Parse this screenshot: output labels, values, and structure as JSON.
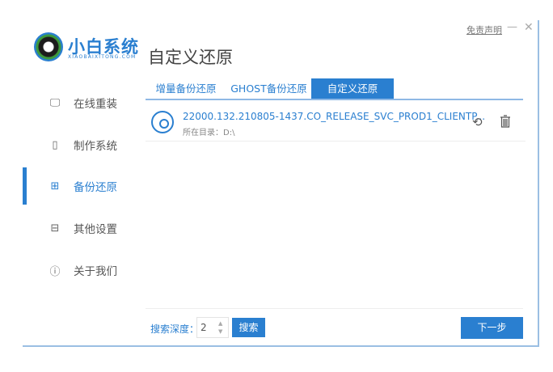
{
  "header": {
    "brand": "小白系统",
    "brand_sub": "XIAOBAIXITONG.COM",
    "title": "自定义还原",
    "disclaimer": "免责声明",
    "minimize": "—",
    "close": "✕"
  },
  "sidebar": {
    "items": [
      {
        "label": "在线重装",
        "icon": "monitor-icon"
      },
      {
        "label": "制作系统",
        "icon": "usb-icon"
      },
      {
        "label": "备份还原",
        "icon": "backup-icon"
      },
      {
        "label": "其他设置",
        "icon": "briefcase-icon"
      },
      {
        "label": "关于我们",
        "icon": "info-icon"
      }
    ],
    "active": 2
  },
  "tabs": [
    {
      "label": "增量备份还原"
    },
    {
      "label": "GHOST备份还原"
    },
    {
      "label": "自定义还原"
    }
  ],
  "file": {
    "name": "22000.132.210805-1437.CO_RELEASE_SVC_PROD1_CLIENTP...",
    "dir": "所在目录：D:\\"
  },
  "footer": {
    "depth_label": "搜索深度：",
    "depth_value": "2",
    "search": "搜索",
    "next": "下一步"
  },
  "colors": {
    "accent": "#2a7fd0"
  }
}
